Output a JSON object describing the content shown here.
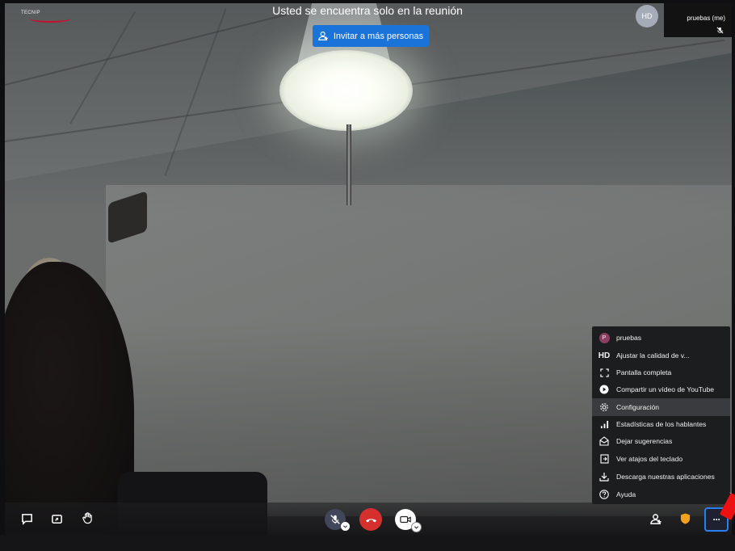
{
  "header": {
    "logo_text": "TECNIP",
    "status_text": "Usted se encuentra solo en la reunión",
    "invite_label": "Invitar a más personas"
  },
  "participant": {
    "avatar_initials": "HD",
    "thumbnail_name": "pruebas (me)"
  },
  "menu": {
    "items": [
      {
        "label": "pruebas",
        "icon": "avatar-p",
        "badge": "P"
      },
      {
        "label": "Ajustar la calidad de v...",
        "icon": "hd-icon",
        "badge": "HD"
      },
      {
        "label": "Pantalla completa",
        "icon": "fullscreen-icon"
      },
      {
        "label": "Compartir un vídeo de YouTube",
        "icon": "play-icon"
      },
      {
        "label": "Configuración",
        "icon": "gear-icon"
      },
      {
        "label": "Estadísticas de los hablantes",
        "icon": "stats-icon"
      },
      {
        "label": "Dejar sugerencias",
        "icon": "feedback-icon"
      },
      {
        "label": "Ver atajos del teclado",
        "icon": "keyboard-shortcuts-icon"
      },
      {
        "label": "Descarga nuestras aplicaciones",
        "icon": "download-icon"
      },
      {
        "label": "Ayuda",
        "icon": "help-icon"
      }
    ],
    "active_index": 4
  },
  "toolbar": {
    "left": [
      "chat-icon",
      "screen-share-icon",
      "raise-hand-icon"
    ],
    "center": [
      "microphone-muted-icon",
      "hangup-icon",
      "camera-icon"
    ],
    "right": [
      "invite-people-icon",
      "security-shield-icon",
      "more-options-icon"
    ],
    "more_label": "···"
  },
  "colors": {
    "invite_button": "#1a73d9",
    "hangup": "#d5302e",
    "shield": "#f4a21c",
    "more_border": "#2a7ef0",
    "menu_bg": "#1c1d1f"
  }
}
